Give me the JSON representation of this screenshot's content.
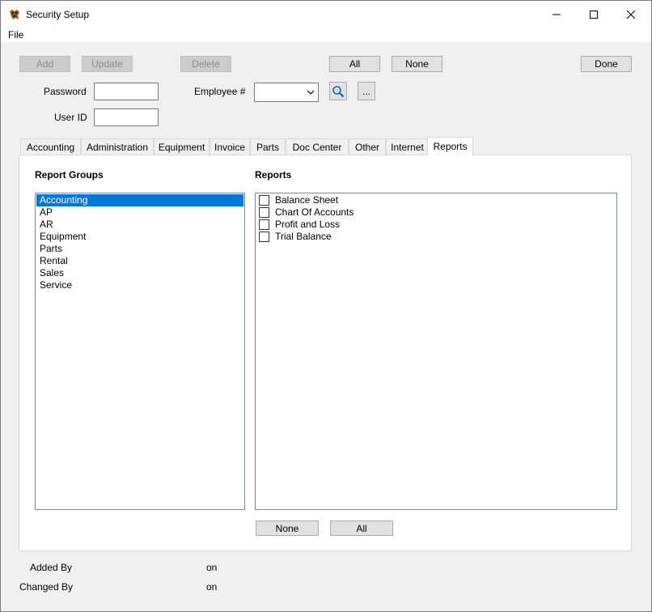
{
  "window": {
    "title": "Security Setup",
    "icon": "dog-app-icon"
  },
  "menubar": {
    "file": "File"
  },
  "toolbar": {
    "add": "Add",
    "update": "Update",
    "delete": "Delete",
    "all": "All",
    "none": "None",
    "done": "Done"
  },
  "form": {
    "password_label": "Password",
    "password_value": "",
    "userid_label": "User ID",
    "userid_value": "",
    "employee_label": "Employee #",
    "employee_value": "",
    "ellipsis": "..."
  },
  "tabs": [
    "Accounting",
    "Administration",
    "Equipment",
    "Invoice",
    "Parts",
    "Doc Center",
    "Other",
    "Internet",
    "Reports"
  ],
  "active_tab": "Reports",
  "report_groups": {
    "title": "Report Groups",
    "items": [
      "Accounting",
      "AP",
      "AR",
      "Equipment",
      "Parts",
      "Rental",
      "Sales",
      "Service"
    ],
    "selected": "Accounting"
  },
  "reports": {
    "title": "Reports",
    "items": [
      {
        "label": "Balance Sheet",
        "checked": false
      },
      {
        "label": "Chart Of Accounts",
        "checked": false
      },
      {
        "label": "Profit and Loss",
        "checked": false
      },
      {
        "label": "Trial Balance",
        "checked": false
      }
    ],
    "none": "None",
    "all": "All"
  },
  "footer": {
    "added_by": "Added By",
    "added_on": "on",
    "changed_by": "Changed By",
    "changed_on": "on"
  },
  "colors": {
    "selection": "#0078d7",
    "window_bg": "#f0f0f0"
  }
}
